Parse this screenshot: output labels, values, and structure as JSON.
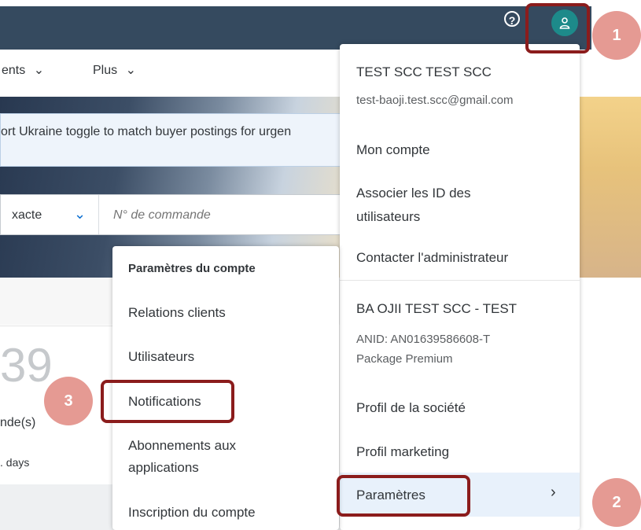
{
  "header": {
    "help_icon": "help-circle-icon",
    "avatar_icon": "user-icon"
  },
  "nav": {
    "item1": "ents",
    "item2": "Plus"
  },
  "notice": {
    "text": "ort Ukraine toggle to match buyer postings for urgen"
  },
  "search": {
    "filter": "xacte",
    "placeholder": "N° de commande"
  },
  "kpi": {
    "value": "39",
    "label": "nde(s)",
    "days": ". days"
  },
  "user_menu": {
    "name": "TEST SCC TEST SCC",
    "email": "test-baoji.test.scc@gmail.com",
    "my_account": "Mon compte",
    "link_ids_line1": "Associer les ID des",
    "link_ids_line2": "utilisateurs",
    "contact_admin": "Contacter l'administrateur",
    "company": "BA OJII TEST SCC - TEST",
    "anid": "ANID: AN01639586608-T",
    "package": "Package Premium",
    "company_profile": "Profil de la société",
    "marketing_profile": "Profil marketing",
    "settings": "Paramètres"
  },
  "settings_menu": {
    "header": "Paramètres du compte",
    "customer_relations": "Relations clients",
    "users": "Utilisateurs",
    "notifications": "Notifications",
    "app_subs_line1": "Abonnements aux",
    "app_subs_line2": "applications",
    "account_registration": "Inscription du compte"
  },
  "annotations": {
    "step1": "1",
    "step2": "2",
    "step3": "3",
    "color": "#8b1c1c",
    "badge_color": "#e59a93"
  }
}
